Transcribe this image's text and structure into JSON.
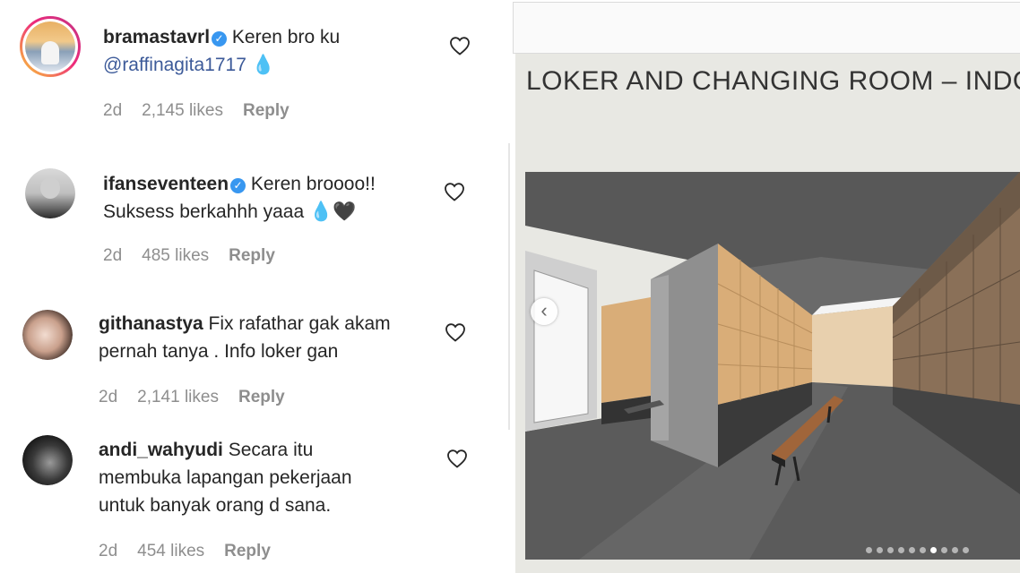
{
  "comments": [
    {
      "username": "bramastavrl",
      "verified": true,
      "text_line1": "Keren bro ku",
      "mention": "@raffinagita1717",
      "text_line2_suffix": "💧",
      "time": "2d",
      "likes": "2,145 likes",
      "reply": "Reply"
    },
    {
      "username": "ifanseventeen",
      "verified": true,
      "text_line1": "Keren broooo!!",
      "text_line2": "Suksess berkahhh yaaa 💧🖤",
      "time": "2d",
      "likes": "485 likes",
      "reply": "Reply"
    },
    {
      "username": "githanastya",
      "verified": false,
      "text_line1": "Fix rafathar gak akam",
      "text_line2": "pernah tanya . Info loker gan",
      "time": "2d",
      "likes": "2,141 likes",
      "reply": "Reply"
    },
    {
      "username": "andi_wahyudi",
      "verified": false,
      "text_line1": "Secara itu",
      "text_line2": "membuka lapangan pekerjaan",
      "text_line3": "untuk banyak orang d sana.",
      "time": "2d",
      "likes": "454 likes",
      "reply": "Reply"
    }
  ],
  "post": {
    "slide_title": "LOKER AND CHANGING ROOM – INDOOR",
    "carousel": {
      "count": 10,
      "active_index": 6
    }
  },
  "icons": {
    "heart": "heart-outline-icon",
    "verified": "verified-badge-icon",
    "prev": "chevron-left-icon"
  },
  "colors": {
    "link": "#3c5a99",
    "verified": "#3897f0",
    "muted": "#8e8e8e"
  }
}
